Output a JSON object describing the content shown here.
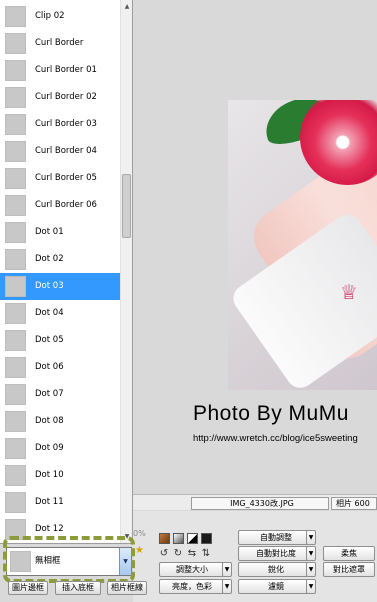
{
  "list": {
    "items": [
      {
        "label": "Clip 02"
      },
      {
        "label": "Curl Border"
      },
      {
        "label": "Curl Border 01"
      },
      {
        "label": "Curl Border 02"
      },
      {
        "label": "Curl Border 03"
      },
      {
        "label": "Curl Border 04"
      },
      {
        "label": "Curl Border 05"
      },
      {
        "label": "Curl Border 06"
      },
      {
        "label": "Dot 01"
      },
      {
        "label": "Dot 02"
      },
      {
        "label": "Dot 03",
        "selected": true
      },
      {
        "label": "Dot 04"
      },
      {
        "label": "Dot 05"
      },
      {
        "label": "Dot 06"
      },
      {
        "label": "Dot 07"
      },
      {
        "label": "Dot 08"
      },
      {
        "label": "Dot 09"
      },
      {
        "label": "Dot 10"
      },
      {
        "label": "Dot 11"
      },
      {
        "label": "Dot 12"
      }
    ]
  },
  "combo": {
    "value": "無相框"
  },
  "photo": {
    "watermark_title": "Photo By MuMu",
    "watermark_url": "http://www.wretch.cc/blog/ice5sweeting"
  },
  "info_bar": {
    "filename": "IMG_4330改.JPG",
    "size_label": "相片 600",
    "percent": "0%"
  },
  "toolbar": {
    "auto_adjust": "自動調整",
    "auto_contrast": "自動對比度",
    "resize": "調整大小",
    "sharpen": "銳化",
    "brightness_color": "亮度，色彩",
    "filter": "濾鏡",
    "soft": "柔焦",
    "contrast_mask": "對比遮罩"
  },
  "bottom_buttons": {
    "image_frame": "圖片邊框",
    "insert_text": "插入底框",
    "photo_frame": "相片框線"
  },
  "colors": {
    "selection": "#3399ff",
    "highlight_dash": "#8e9b3a"
  }
}
